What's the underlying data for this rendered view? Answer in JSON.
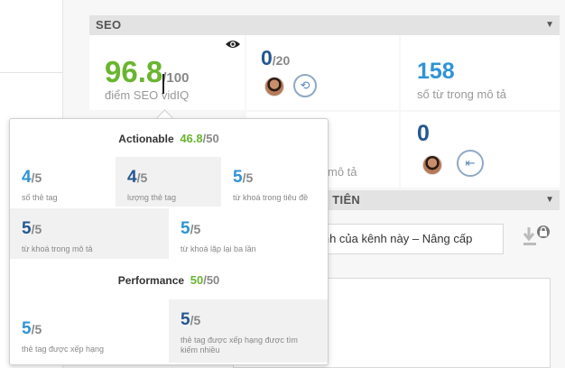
{
  "seo_section": {
    "title": "SEO",
    "caret": "▼"
  },
  "score_card": {
    "score": "96.8",
    "max": "/100",
    "label": "điểm SEO vidIQ"
  },
  "tags_card": {
    "value": "0",
    "max": "/20"
  },
  "desc_words_card": {
    "value": "158",
    "label": "số từ trong mô tả"
  },
  "row2": {
    "partial_label": "mô tả",
    "value": "0"
  },
  "second_section": {
    "title_partial": "ẦU TIÊN",
    "caret": "▼"
  },
  "upgrade_text": "bình của kênh này  –  Nâng cấp",
  "popover": {
    "actionable": {
      "title": "Actionable",
      "score": "46.8",
      "total": "/50"
    },
    "performance": {
      "title": "Performance",
      "score": "50",
      "total": "/50"
    },
    "metrics": [
      {
        "value": "4",
        "den": "/5",
        "label": "số thẻ tag"
      },
      {
        "value": "4",
        "den": "/5",
        "label": "lượng thẻ tag"
      },
      {
        "value": "5",
        "den": "/5",
        "label": "từ khoá trong tiêu đề"
      },
      {
        "value": "5",
        "den": "/5",
        "label": "từ khoá trong mô tả"
      },
      {
        "value": "5",
        "den": "/5",
        "label": "từ khoá lặp lại ba lần"
      },
      {
        "value": "5",
        "den": "/5",
        "label": "thẻ tag được xếp hạng"
      },
      {
        "value": "5",
        "den": "/5",
        "label": "thẻ tag được xếp hạng được tìm kiếm nhiều"
      }
    ]
  },
  "icons": {
    "eye": "eye-icon",
    "link": "link-icon",
    "user_add": "user-add-icon",
    "download": "download-lock-icon"
  },
  "colors": {
    "score_green": "#6ab52f",
    "metric_blue": "#2f93d6",
    "metric_dark": "#24578f"
  }
}
